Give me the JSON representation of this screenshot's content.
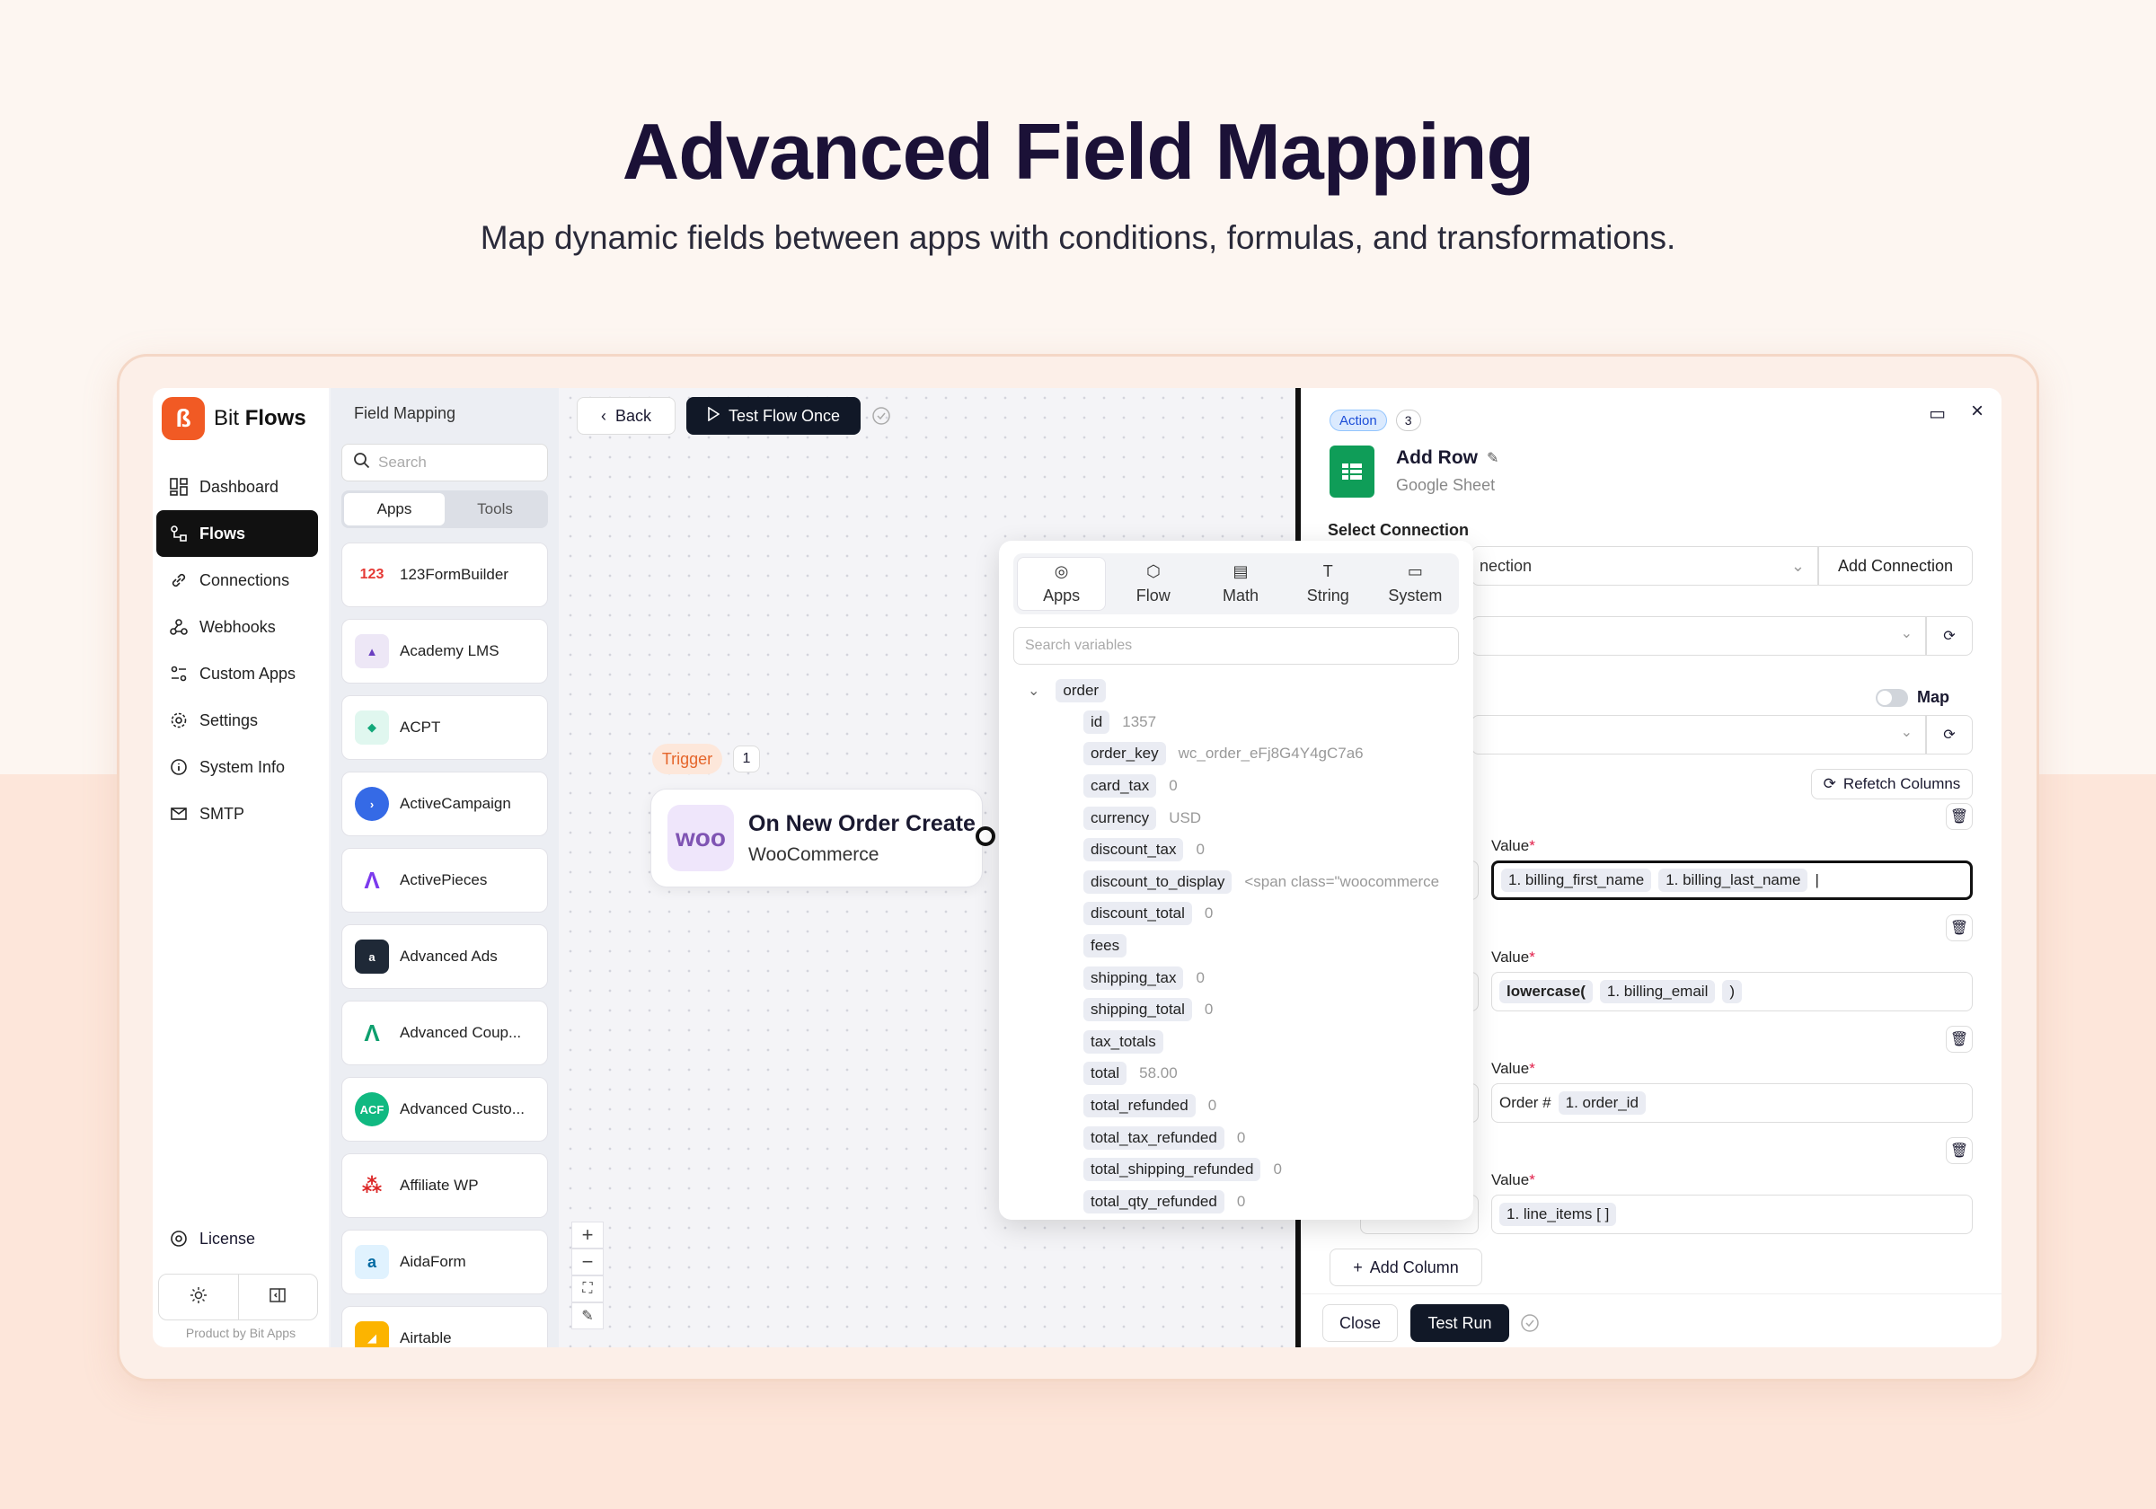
{
  "hero": {
    "title": "Advanced Field Mapping",
    "subtitle": "Map dynamic fields between apps with conditions, formulas, and transformations."
  },
  "brand": {
    "name_light": "Bit ",
    "name_bold": "Flows",
    "footer": "Product by Bit Apps",
    "accent": "#f15a24"
  },
  "sidebar": {
    "items": [
      {
        "label": "Dashboard",
        "icon": "dashboard-icon"
      },
      {
        "label": "Flows",
        "icon": "flows-icon"
      },
      {
        "label": "Connections",
        "icon": "link-icon"
      },
      {
        "label": "Webhooks",
        "icon": "webhook-icon"
      },
      {
        "label": "Custom Apps",
        "icon": "custom-apps-icon"
      },
      {
        "label": "Settings",
        "icon": "gear-icon"
      },
      {
        "label": "System Info",
        "icon": "info-icon"
      },
      {
        "label": "SMTP",
        "icon": "mail-icon"
      }
    ],
    "license": "License"
  },
  "field_mapping": {
    "title": "Field Mapping",
    "search_placeholder": "Search",
    "tabs": [
      "Apps",
      "Tools"
    ],
    "apps": [
      "123FormBuilder",
      "Academy LMS",
      "ACPT",
      "ActiveCampaign",
      "ActivePieces",
      "Advanced Ads",
      "Advanced Coup...",
      "Advanced Custo...",
      "Affiliate WP",
      "AidaForm",
      "Airtable"
    ]
  },
  "canvas": {
    "back": "Back",
    "test_flow": "Test Flow Once",
    "trigger_label": "Trigger",
    "trigger_num": "1",
    "node_title": "On New Order Create",
    "node_sub": "WooCommerce",
    "node_logo": "woo"
  },
  "variables": {
    "tabs": [
      "Apps",
      "Flow",
      "Math",
      "String",
      "System"
    ],
    "search_placeholder": "Search variables",
    "group": "order",
    "rows": [
      {
        "key": "id",
        "val": "1357"
      },
      {
        "key": "order_key",
        "val": "wc_order_eFj8G4Y4gC7a6"
      },
      {
        "key": "card_tax",
        "val": "0"
      },
      {
        "key": "currency",
        "val": "USD"
      },
      {
        "key": "discount_tax",
        "val": "0"
      },
      {
        "key": "discount_to_display",
        "val": "<span class=\"woocommerce"
      },
      {
        "key": "discount_total",
        "val": "0"
      },
      {
        "key": "fees",
        "val": ""
      },
      {
        "key": "shipping_tax",
        "val": "0"
      },
      {
        "key": "shipping_total",
        "val": "0"
      },
      {
        "key": "tax_totals",
        "val": ""
      },
      {
        "key": "total",
        "val": "58.00"
      },
      {
        "key": "total_refunded",
        "val": "0"
      },
      {
        "key": "total_tax_refunded",
        "val": "0"
      },
      {
        "key": "total_shipping_refunded",
        "val": "0"
      },
      {
        "key": "total_qty_refunded",
        "val": "0"
      }
    ]
  },
  "action": {
    "badge": "Action",
    "num": "3",
    "title": "Add Row",
    "sub": "Google Sheet",
    "select_connection": "Select Connection",
    "connection_value": "nection",
    "add_connection": "Add Connection",
    "map_label": "Map",
    "refetch": "Refetch Columns",
    "value_label": "Value",
    "v1_chips": [
      "1. billing_first_name",
      "1. billing_last_name"
    ],
    "v2_pre": "lowercase(",
    "v2_chip": "1. billing_email",
    "v2_post": ")",
    "v3_pre": "Order #",
    "v3_chip": "1. order_id",
    "v4_chip": "1. line_items [ ]",
    "add_column": "Add Column",
    "close": "Close",
    "test_run": "Test Run"
  }
}
